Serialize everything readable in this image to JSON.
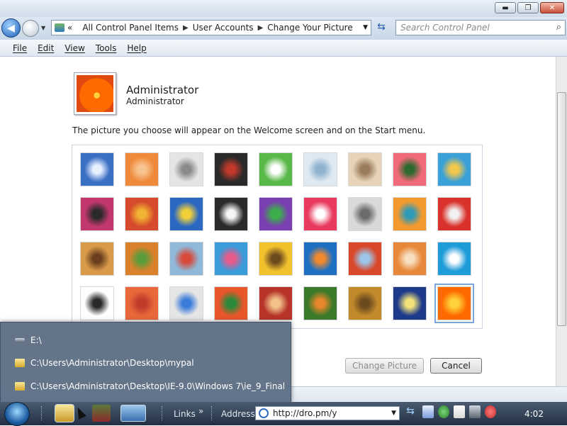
{
  "window": {
    "controls": {
      "minimize": "▬",
      "maximize": "❐",
      "close": "✕"
    }
  },
  "address": {
    "history_overflow": "«",
    "breadcrumb": [
      "All Control Panel Items",
      "User Accounts",
      "Change Your Picture"
    ],
    "search_placeholder": "Search Control Panel"
  },
  "menu": [
    "File",
    "Edit",
    "View",
    "Tools",
    "Help"
  ],
  "user": {
    "name": "Administrator",
    "role": "Administrator"
  },
  "description": "The picture you choose will appear on the Welcome screen and on the Start menu.",
  "pictures": [
    {
      "name": "ferris-wheel",
      "c1": "#3b6fc4",
      "c2": "#e8f0ff"
    },
    {
      "name": "starfish",
      "c1": "#f08a3a",
      "c2": "#f7c38e"
    },
    {
      "name": "robot",
      "c1": "#e5e5e5",
      "c2": "#8a8a8a"
    },
    {
      "name": "turntable",
      "c1": "#2a2a2a",
      "c2": "#c0392b"
    },
    {
      "name": "lucky-cat",
      "c1": "#58b848",
      "c2": "#ffffff"
    },
    {
      "name": "gyroscope",
      "c1": "#dfe9f2",
      "c2": "#8fb3cf"
    },
    {
      "name": "kitten",
      "c1": "#e6d3b8",
      "c2": "#9a7b5a"
    },
    {
      "name": "pink-flower",
      "c1": "#f06a7a",
      "c2": "#2d6a2d"
    },
    {
      "name": "pinwheel",
      "c1": "#3aa0d8",
      "c2": "#f2c94c"
    },
    {
      "name": "ball",
      "c1": "#c2386e",
      "c2": "#2a2a2a"
    },
    {
      "name": "fabric",
      "c1": "#d64b2b",
      "c2": "#f2b233"
    },
    {
      "name": "leaf",
      "c1": "#2a68c2",
      "c2": "#f2d03a"
    },
    {
      "name": "dog",
      "c1": "#2a2a2a",
      "c2": "#f5f5f5"
    },
    {
      "name": "crayons",
      "c1": "#7a3fb0",
      "c2": "#3bb04a"
    },
    {
      "name": "star",
      "c1": "#e83a5e",
      "c2": "#ffffff"
    },
    {
      "name": "jacks",
      "c1": "#d9d9d9",
      "c2": "#6b6b6b"
    },
    {
      "name": "stairs",
      "c1": "#f29a2e",
      "c2": "#2f9ab8"
    },
    {
      "name": "paper-crane",
      "c1": "#d9312b",
      "c2": "#f2f2f2"
    },
    {
      "name": "guitar",
      "c1": "#d99a4a",
      "c2": "#6b3f1e"
    },
    {
      "name": "pomeranian",
      "c1": "#d9822b",
      "c2": "#5a9b3a"
    },
    {
      "name": "toy-robot",
      "c1": "#8fb8d9",
      "c2": "#d94a3a"
    },
    {
      "name": "scarf",
      "c1": "#3a9bd9",
      "c2": "#e85a8a"
    },
    {
      "name": "sunflower",
      "c1": "#f2c12e",
      "c2": "#6b4a1e"
    },
    {
      "name": "fish",
      "c1": "#1e6fc2",
      "c2": "#f28a2e"
    },
    {
      "name": "balloon",
      "c1": "#d9482b",
      "c2": "#9cc7ea"
    },
    {
      "name": "doll",
      "c1": "#e8883a",
      "c2": "#f7e0c2"
    },
    {
      "name": "sailboat",
      "c1": "#1e9bd9",
      "c2": "#ffffff"
    },
    {
      "name": "soccer-ball",
      "c1": "#ffffff",
      "c2": "#2a2a2a"
    },
    {
      "name": "silk",
      "c1": "#e8683a",
      "c2": "#c23a2a"
    },
    {
      "name": "marbles",
      "c1": "#e5e5e5",
      "c2": "#3a7ad9"
    },
    {
      "name": "window-frame",
      "c1": "#e8562b",
      "c2": "#2a8a3a"
    },
    {
      "name": "woven",
      "c1": "#b8342a",
      "c2": "#f2c28a"
    },
    {
      "name": "butterfly",
      "c1": "#3a7a2a",
      "c2": "#e8862b"
    },
    {
      "name": "spiral",
      "c1": "#c28a2a",
      "c2": "#6b4a1e"
    },
    {
      "name": "lighthouse",
      "c1": "#1e3a8a",
      "c2": "#f2e27a"
    },
    {
      "name": "orange-flower",
      "c1": "#ff6a00",
      "c2": "#ffd23a"
    }
  ],
  "buttons": {
    "change_picture": "Change Picture",
    "cancel": "Cancel"
  },
  "jumplist": {
    "items": [
      {
        "label": "E:\\",
        "icon": "drive-icon"
      },
      {
        "label": "C:\\Users\\Administrator\\Desktop\\mypal",
        "icon": "folder-icon"
      },
      {
        "label": "C:\\Users\\Administrator\\Desktop\\IE-9.0\\Windows 7\\ie_9_Final",
        "icon": "folder-icon"
      }
    ]
  },
  "taskbar": {
    "links_label": "Links",
    "address_label": "Address",
    "address_value": "http://dro.pm/y",
    "clock": "4:02"
  }
}
